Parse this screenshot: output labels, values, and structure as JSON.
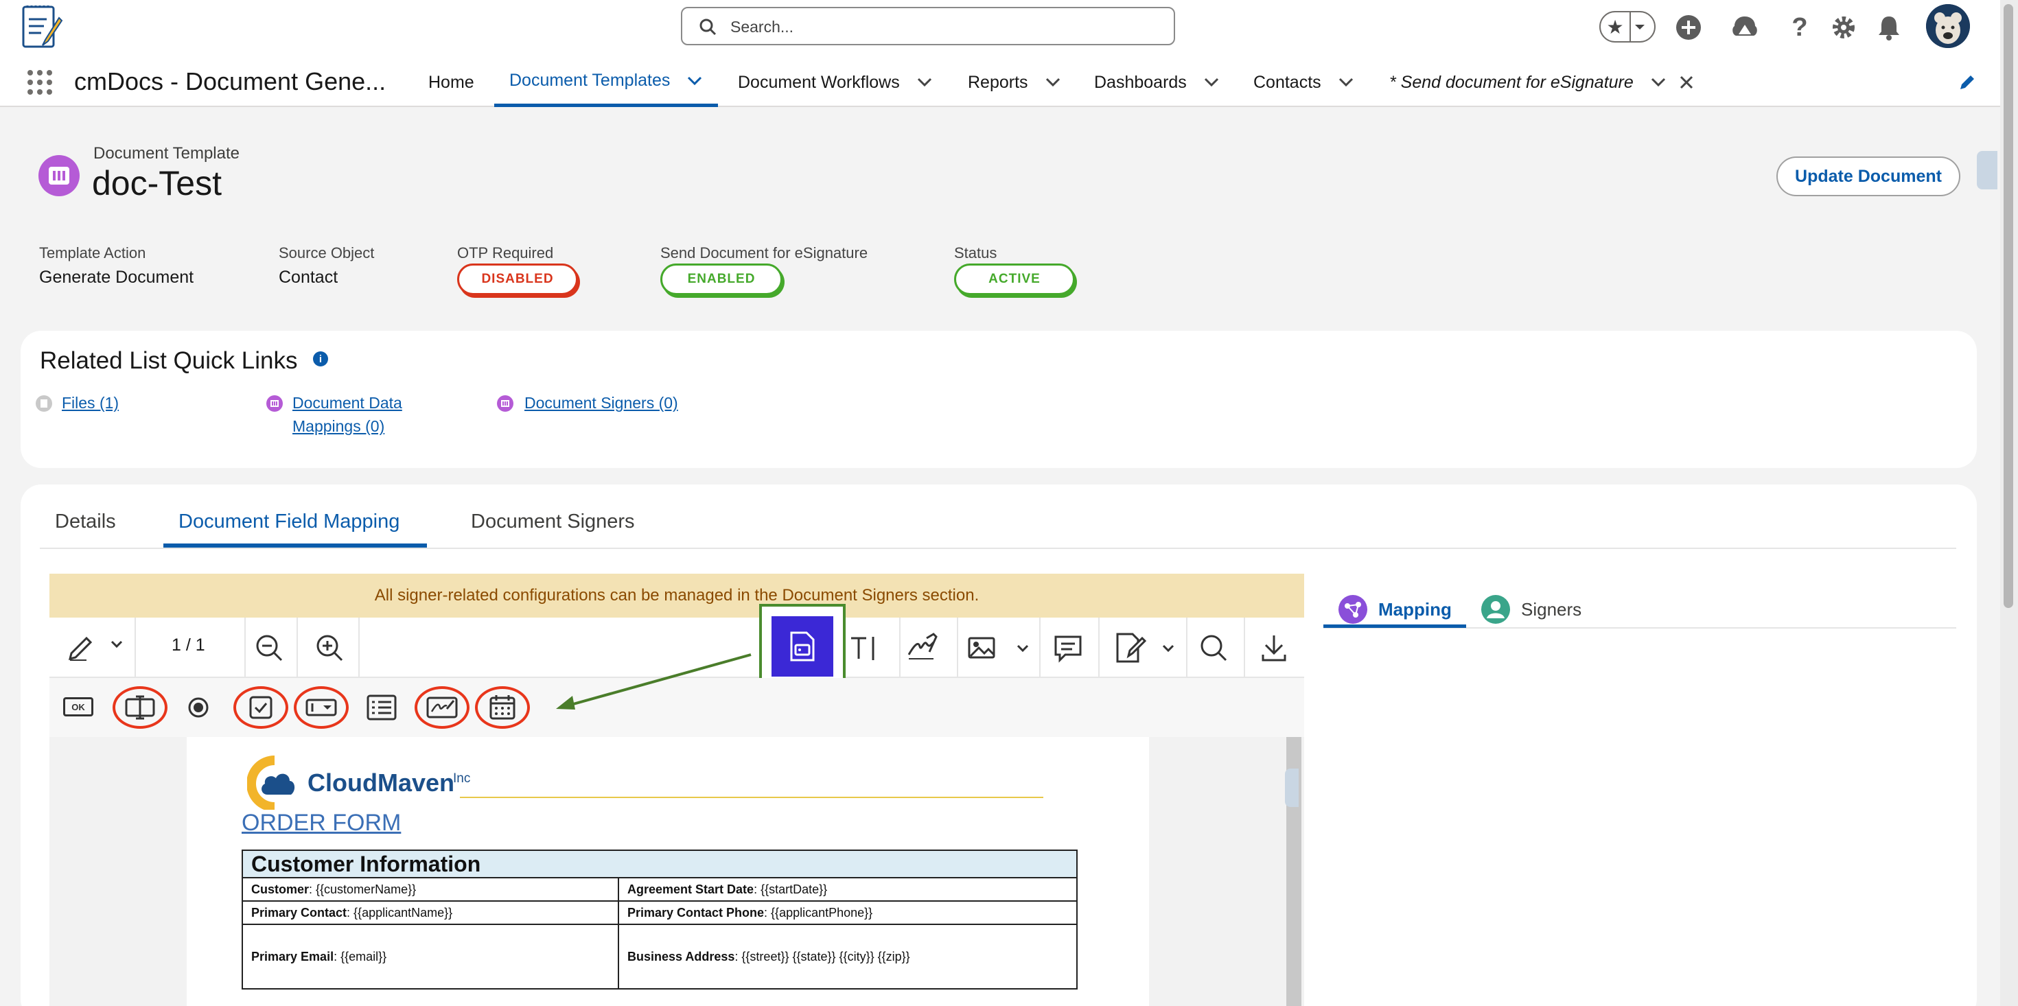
{
  "header": {
    "search_placeholder": "Search...",
    "icons": [
      "favorites-star-icon",
      "add-icon",
      "trailhead-icon",
      "help-icon",
      "gear-icon",
      "bell-icon",
      "avatar"
    ]
  },
  "nav": {
    "app_name": "cmDocs - Document Gene...",
    "items": [
      {
        "label": "Home",
        "has_menu": false
      },
      {
        "label": "Document Templates",
        "has_menu": true,
        "active": true
      },
      {
        "label": "Document Workflows",
        "has_menu": true
      },
      {
        "label": "Reports",
        "has_menu": true
      },
      {
        "label": "Dashboards",
        "has_menu": true
      },
      {
        "label": "Contacts",
        "has_menu": true
      },
      {
        "label": "* Send document for eSignature",
        "has_menu": true,
        "closable": true
      }
    ]
  },
  "record": {
    "type_label": "Document Template",
    "title": "doc-Test",
    "update_button": "Update Document",
    "fields": [
      {
        "label": "Template Action",
        "value": "Generate Document"
      },
      {
        "label": "Source Object",
        "value": "Contact"
      },
      {
        "label": "OTP Required",
        "badge": "DISABLED"
      },
      {
        "label": "Send Document for eSignature",
        "badge": "ENABLED"
      },
      {
        "label": "Status",
        "badge": "ACTIVE"
      }
    ]
  },
  "quick_links": {
    "title": "Related List Quick Links",
    "info_glyph": "i",
    "links": [
      {
        "label": "Files (1)"
      },
      {
        "label_line1": "Document Data",
        "label_line2": "Mappings (0)"
      },
      {
        "label": "Document Signers (0)"
      }
    ]
  },
  "tabs": [
    "Details",
    "Document Field Mapping",
    "Document Signers"
  ],
  "mapping": {
    "banner": "All signer-related configurations can be managed in the Document Signers section.",
    "page_indicator": "1 / 1",
    "ok_label": "OK",
    "annotations": [
      "A",
      "B",
      "C",
      "D",
      "E"
    ],
    "right_tabs": [
      "Mapping",
      "Signers"
    ]
  },
  "document": {
    "logo_text": "CloudMaven",
    "logo_sup": "Inc",
    "heading": "ORDER FORM",
    "section_title": "Customer Information",
    "rows": [
      {
        "l_label": "Customer",
        "l_value": ": {{customerName}}",
        "r_label": "Agreement Start Date",
        "r_value": ": {{startDate}}"
      },
      {
        "l_label": "Primary Contact",
        "l_value": ": {{applicantName}}",
        "r_label": "Primary Contact Phone",
        "r_value": ": {{applicantPhone}}"
      },
      {
        "l_label": "Primary Email",
        "l_value": ": {{email}}",
        "r_label": "Business Address",
        "r_value": ": {{street}} {{state}} {{city}} {{zip}}"
      }
    ]
  },
  "colors": {
    "brand_blue": "#0b5cab",
    "highlight_green": "#4a8c2e",
    "annotation_red": "#e8361b",
    "active_tool": "#3b28d6",
    "badge_red": "#d9351c",
    "badge_green": "#45a92b"
  }
}
